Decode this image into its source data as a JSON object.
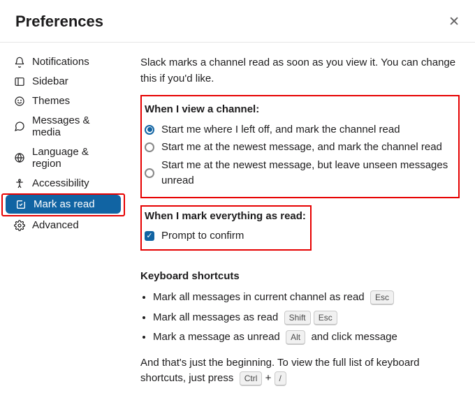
{
  "header": {
    "title": "Preferences"
  },
  "sidebar": {
    "items": [
      {
        "label": "Notifications"
      },
      {
        "label": "Sidebar"
      },
      {
        "label": "Themes"
      },
      {
        "label": "Messages & media"
      },
      {
        "label": "Language & region"
      },
      {
        "label": "Accessibility"
      },
      {
        "label": "Mark as read"
      },
      {
        "label": "Advanced"
      }
    ],
    "selected_index": 6
  },
  "main": {
    "intro": "Slack marks a channel read as soon as you view it. You can change this if you'd like.",
    "view_channel": {
      "title": "When I view a channel:",
      "options": [
        "Start me where I left off, and mark the channel read",
        "Start me at the newest message, and mark the channel read",
        "Start me at the newest message, but leave unseen messages unread"
      ],
      "selected": 0
    },
    "mark_all": {
      "title": "When I mark everything as read:",
      "checkbox_label": "Prompt to confirm",
      "checked": true
    },
    "shortcuts": {
      "title": "Keyboard shortcuts",
      "items": [
        {
          "text": "Mark all messages in current channel as read",
          "keys": [
            "Esc"
          ]
        },
        {
          "text": "Mark all messages as read",
          "keys": [
            "Shift",
            "Esc"
          ]
        },
        {
          "text_before": "Mark a message as unread",
          "keys": [
            "Alt"
          ],
          "text_after": "and click message"
        }
      ],
      "footer_before": "And that's just the beginning. To view the full list of keyboard shortcuts, just press",
      "footer_keys": [
        "Ctrl",
        "/"
      ],
      "footer_plus": "+"
    }
  }
}
